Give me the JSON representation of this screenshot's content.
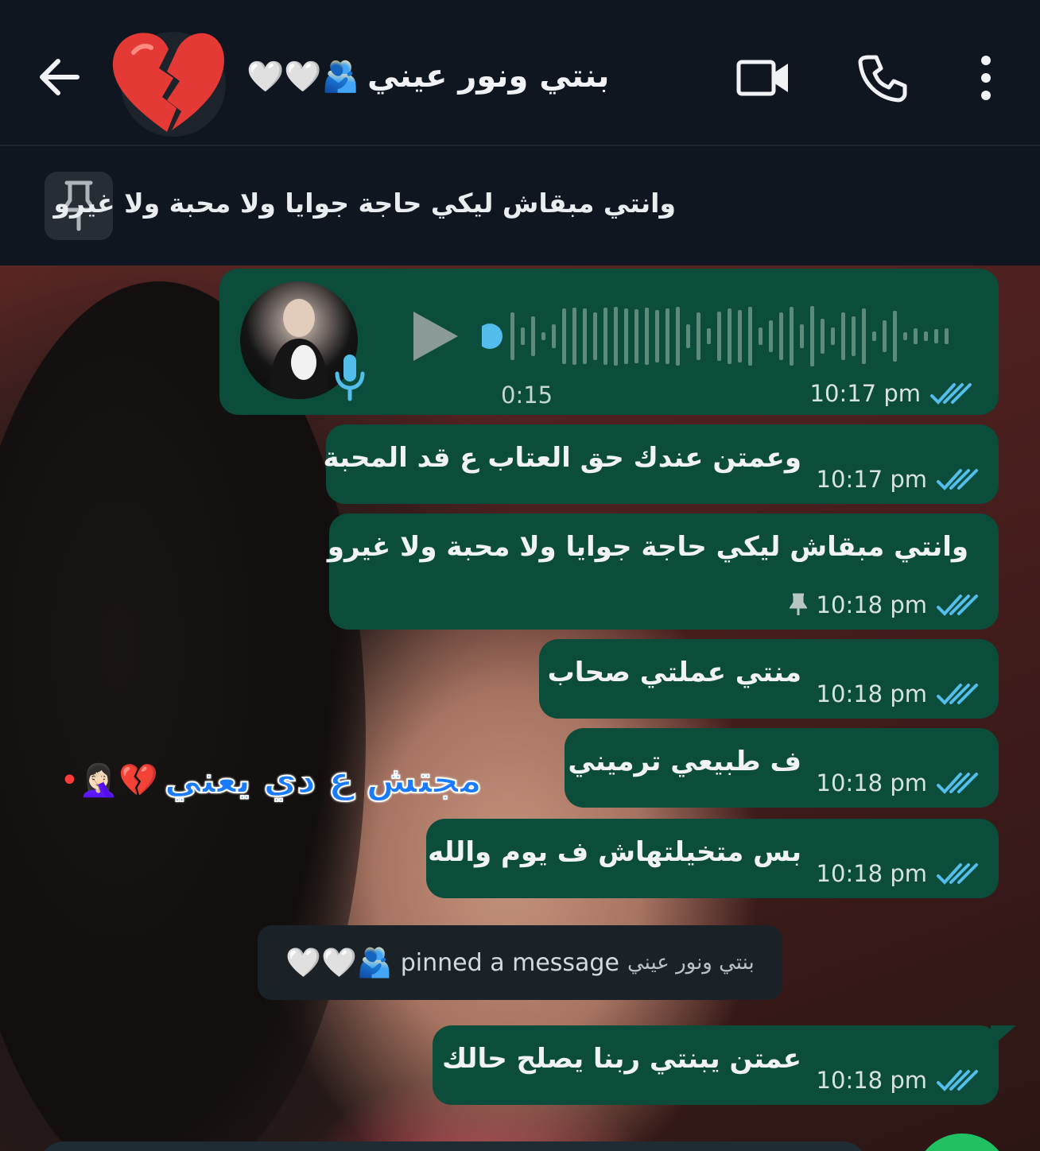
{
  "header": {
    "back_icon": "arrow-left-icon",
    "avatar_icon": "broken-heart-emoji",
    "title": "بنتي ونور عيني",
    "title_emoji": "🫂🤍🤍",
    "video_icon": "video-camera-icon",
    "call_icon": "phone-icon",
    "menu_icon": "more-vertical-icon"
  },
  "pinned": {
    "icon": "pin-icon",
    "text": "وانتي مبقاش ليكي حاجة جوايا ولا محبة ولا غيرو"
  },
  "voice_message": {
    "duration": "0:15",
    "time": "10:17 pm",
    "status": "read"
  },
  "messages": [
    {
      "text": "وعمتن عندك حق العتاب ع قد المحبة",
      "time": "10:17 pm"
    },
    {
      "text": "وانتي مبقاش ليكي حاجة جوايا ولا محبة ولا غيرو",
      "time": "10:18 pm",
      "pinned": true
    },
    {
      "text": "منتي عملتي صحاب",
      "time": "10:18 pm"
    },
    {
      "text": "ف طبيعي ترميني",
      "time": "10:18 pm"
    },
    {
      "text": "بس متخيلتهاش ف يوم والله",
      "time": "10:18 pm"
    },
    {
      "text": "عمتن يبنتي ربنا يصلح حالك",
      "time": "10:18 pm"
    }
  ],
  "system_message": {
    "name": "بنتي ونور عيني",
    "text": "pinned a message",
    "emoji": "🫂🤍🤍"
  },
  "overlay": {
    "text": "مجتش ع دي يعني",
    "emoji": "💔🤦🏻‍♀️•"
  },
  "colors": {
    "bubble": "#0b4d3a",
    "header": "#0f1620",
    "tick": "#53bdeb",
    "overlay_text": "#1a7bff"
  }
}
